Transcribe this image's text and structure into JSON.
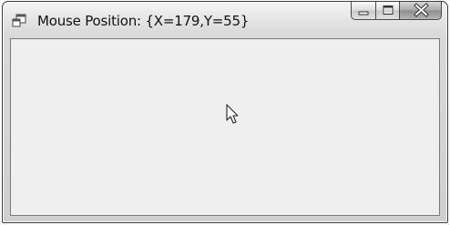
{
  "window": {
    "title": "Mouse Position: {X=179,Y=55}"
  },
  "icons": {
    "app": "app-icon",
    "minimize": "minimize-icon",
    "maximize": "maximize-icon",
    "close": "close-icon",
    "cursor": "mouse-pointer-icon"
  },
  "colors": {
    "client_background": "#efefef",
    "frame": "#d6d6d6"
  }
}
